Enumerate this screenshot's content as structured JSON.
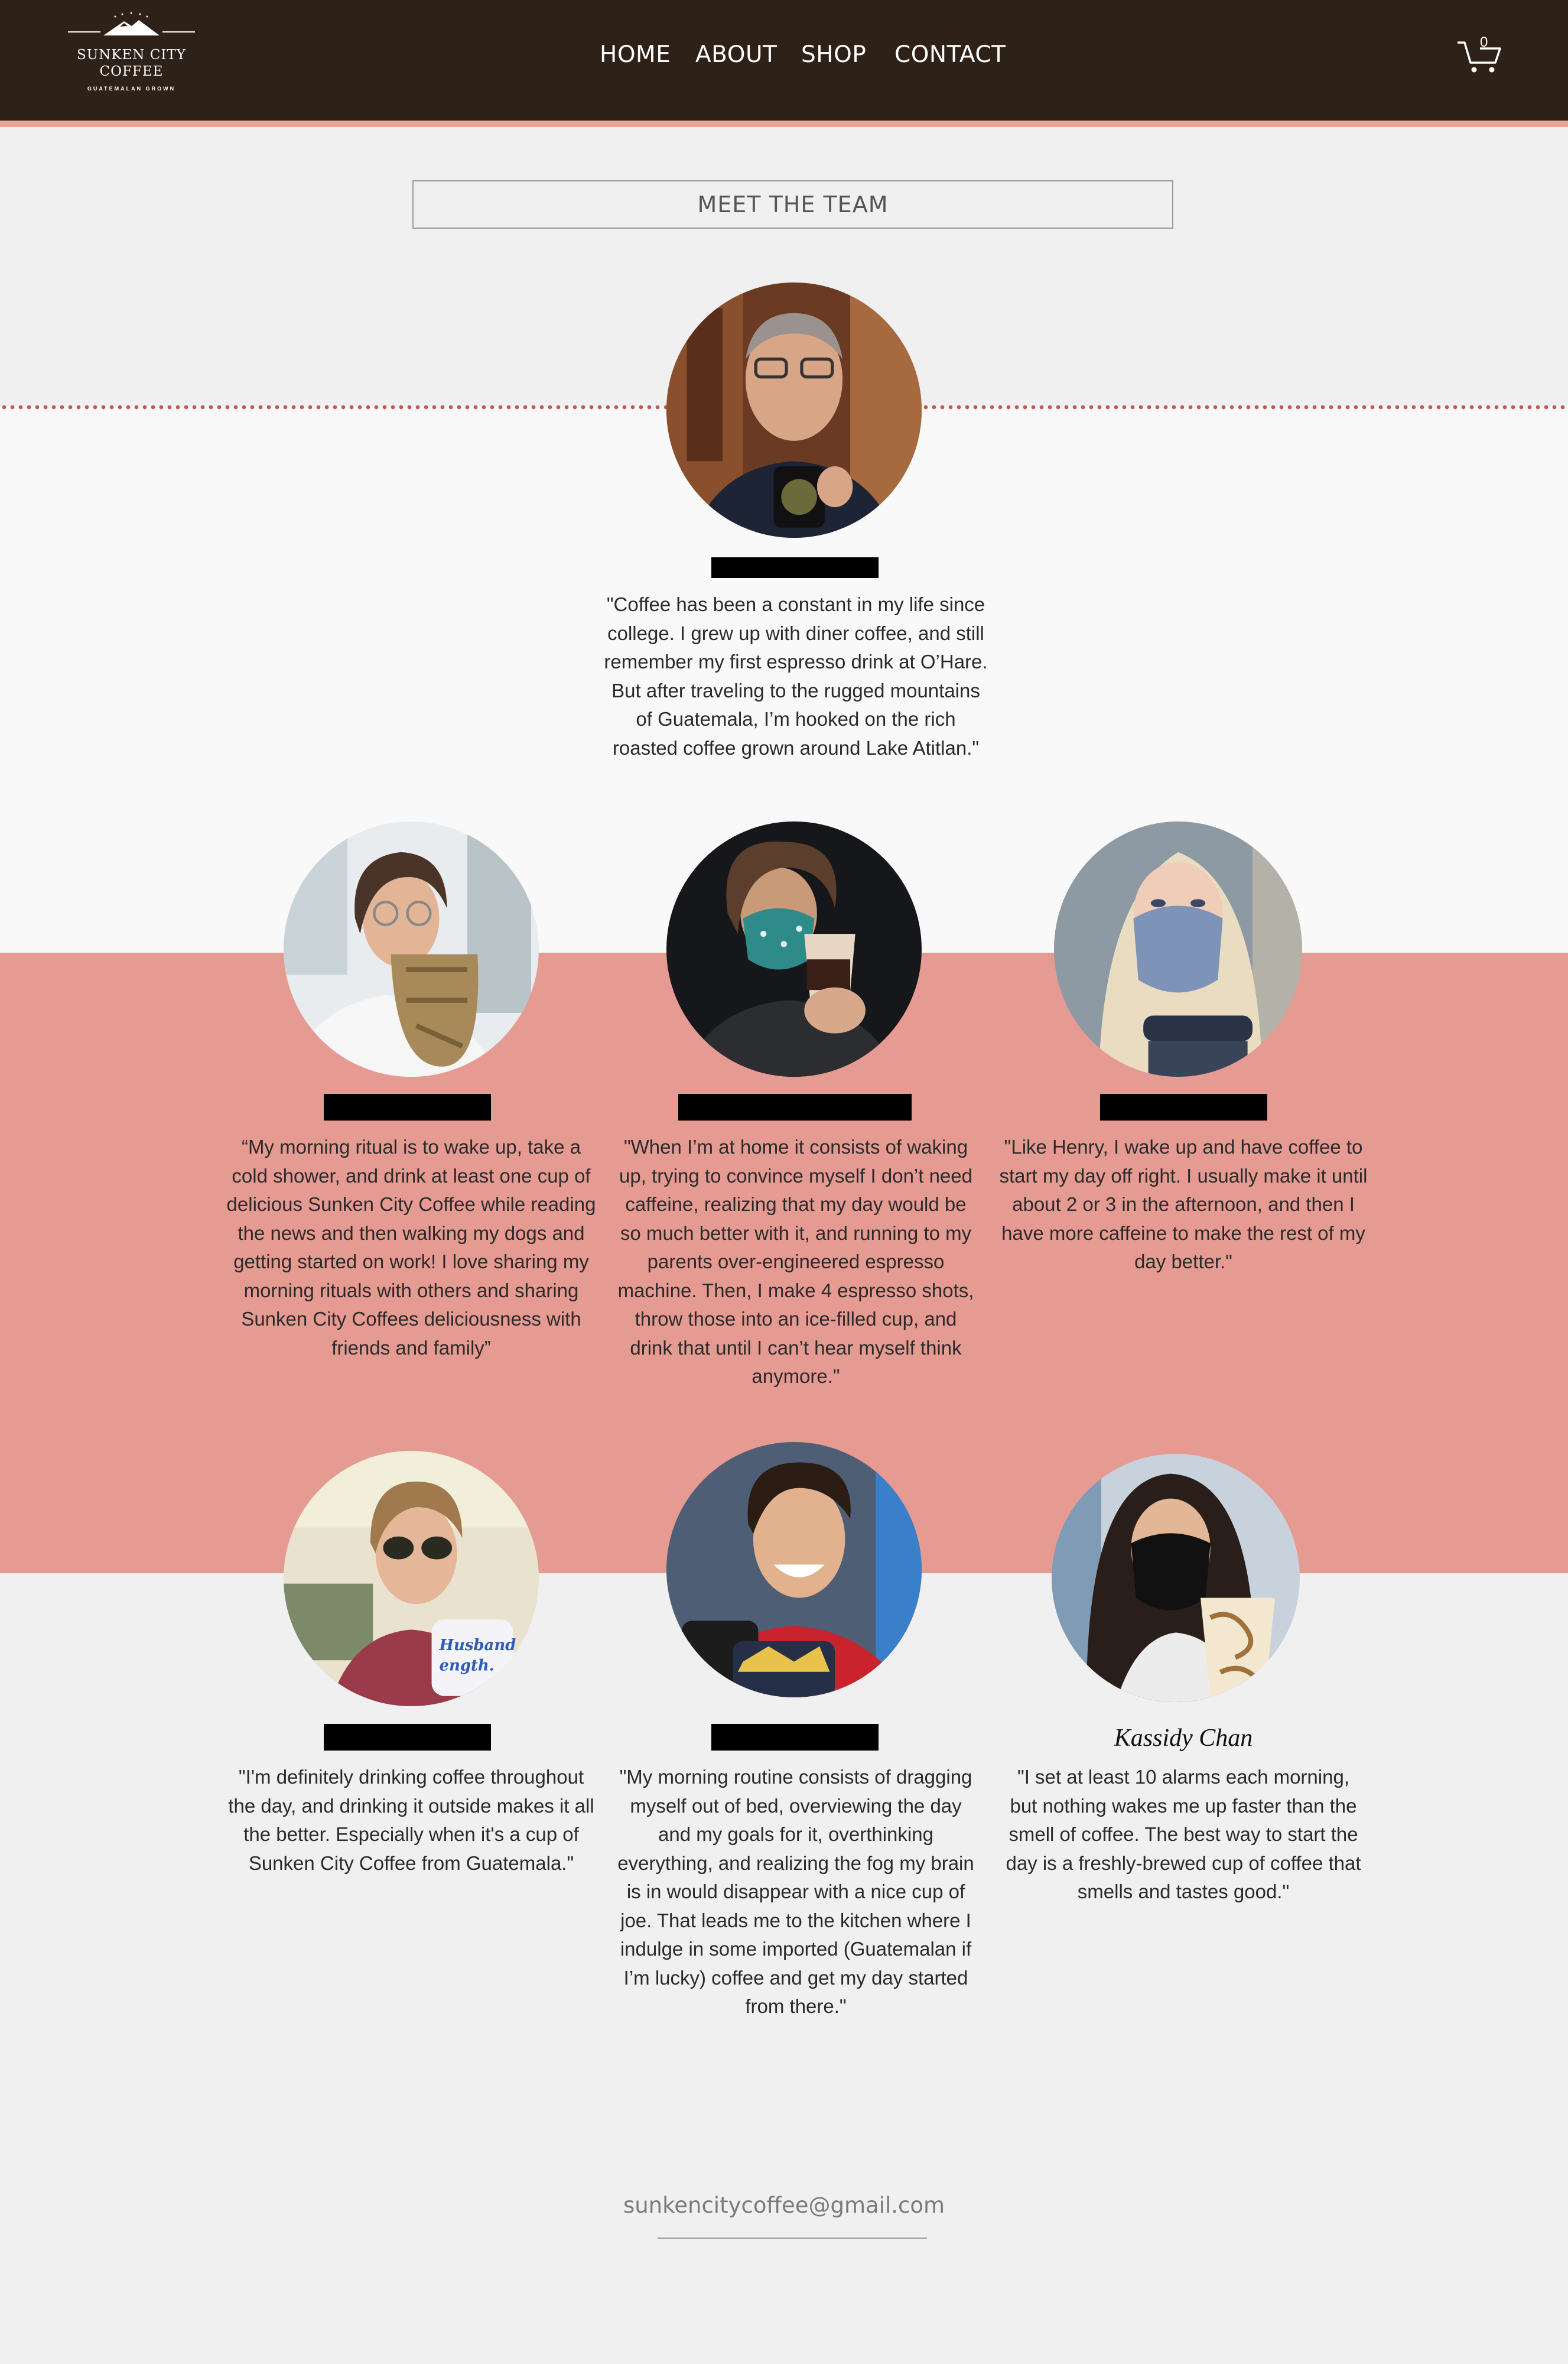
{
  "header": {
    "logo": {
      "line1": "SUNKEN CITY",
      "line2": "COFFEE",
      "line3": "GUATEMALAN GROWN"
    },
    "nav": [
      "HOME",
      "ABOUT",
      "SHOP",
      "CONTACT"
    ],
    "cart_count": "0",
    "colors": {
      "header_bg": "#2e2117",
      "accent": "#e8a598"
    }
  },
  "section": {
    "title": "MEET THE TEAM",
    "band_color": "#e69b92"
  },
  "members": [
    {
      "name": "",
      "name_redacted": true,
      "photo": "photo-older-man-glasses-mug",
      "quote": "\"Coffee has been a constant in my life since college. I grew up with diner coffee, and still remember my first espresso drink at O’Hare. But after traveling to the rugged mountains of Guatemala, I’m hooked on the rich roasted coffee grown around Lake Atitlan.\""
    },
    {
      "name": "",
      "name_redacted": true,
      "photo": "photo-glasses-carved-mug",
      "quote": "“My morning ritual is to wake up, take a cold shower, and drink at least one cup of delicious Sunken City Coffee while reading the news and then walking my dogs and getting started on work! I love sharing my morning rituals with others and sharing Sunken City Coffees deliciousness with friends and family”"
    },
    {
      "name": "",
      "name_redacted": true,
      "photo": "photo-teal-mask-cup",
      "quote": "\"When I’m at home it consists of waking up, trying to convince myself I don’t need caffeine, realizing that my day would be so much better with it, and running to my parents over-engineered espresso machine. Then, I make 4 espresso shots, throw those into an ice-filled cup, and drink that until I can’t hear myself think anymore.\""
    },
    {
      "name": "",
      "name_redacted": true,
      "photo": "photo-blue-mask-tumbler",
      "quote": "\"Like Henry, I wake up and have coffee to start my day off right. I usually make it until about 2 or 3 in the afternoon, and then I have more caffeine to make the rest of my day better.\""
    },
    {
      "name": "",
      "name_redacted": true,
      "photo": "photo-sunglasses-mug",
      "quote": "\"I'm definitely drinking coffee throughout the day, and drinking it outside makes it all the better. Especially when it's a cup of Sunken City Coffee from Guatemala.\"",
      "mug_text": [
        "Husband,",
        "ength."
      ]
    },
    {
      "name": "",
      "name_redacted": true,
      "photo": "photo-smiling-mug",
      "quote": "\"My morning routine consists of dragging myself out of bed, overviewing the day and my goals for it, overthinking everything, and realizing the fog my brain is in would disappear with a nice cup of joe. That leads me to the kitchen where I indulge in some imported (Guatemalan if I’m lucky) coffee and get my day started from there.\""
    },
    {
      "name": "Kassidy Chan",
      "name_redacted": false,
      "photo": "photo-black-mask-cup",
      "quote": "\"I set at least 10 alarms each morning, but nothing wakes me up faster than the smell of coffee. The best way to start the day is a freshly-brewed cup of coffee that smells and tastes good.\""
    }
  ],
  "footer": {
    "email": "sunkencitycoffee@gmail.com"
  }
}
